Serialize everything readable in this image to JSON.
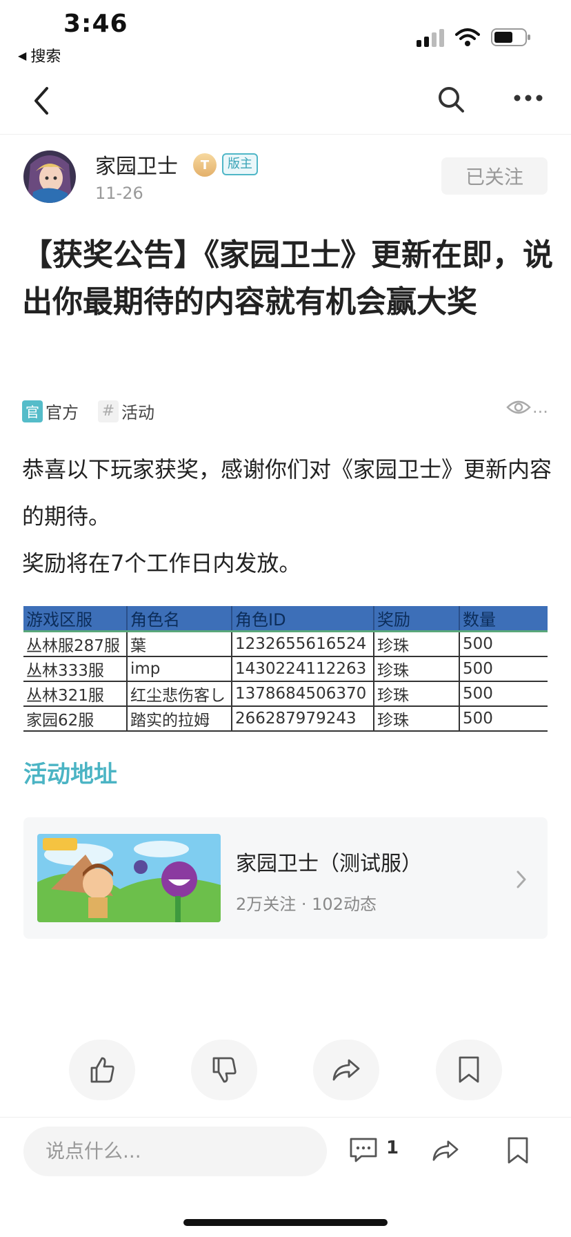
{
  "status_bar": {
    "time": "3:46",
    "back_app": "搜索"
  },
  "author": {
    "name": "家园卫士",
    "level": "T",
    "role_badge": "版主",
    "date": "11-26",
    "follow_label": "已关注"
  },
  "post": {
    "title": "【获奖公告】《家园卫士》更新在即，说出你最期待的内容就有机会赢大奖",
    "tags": [
      {
        "mark": "官",
        "label": "官方"
      },
      {
        "mark": "#",
        "label": "活动"
      }
    ],
    "views_suffix": "...",
    "paragraph_1": "恭喜以下玩家获奖，感谢你们对《家园卫士》更新内容的期待。",
    "paragraph_2": "奖励将在7个工作日内发放。"
  },
  "award_table": {
    "headers": [
      "游戏区服",
      "角色名",
      "角色ID",
      "奖励",
      "数量"
    ],
    "rows": [
      [
        "丛林服287服",
        "葉",
        "1232655616524",
        "珍珠",
        "500"
      ],
      [
        "丛林333服",
        "imp",
        "1430224112263",
        "珍珠",
        "500"
      ],
      [
        "丛林321服",
        "红尘悲伤客し",
        "1378684506370",
        "珍珠",
        "500"
      ],
      [
        "家园62服",
        "踏实的拉姆",
        "266287979243",
        "珍珠",
        "500"
      ]
    ]
  },
  "link_heading": "活动地址",
  "game_card": {
    "name": "家园卫士（测试服）",
    "stats": "2万关注 · 102动态"
  },
  "bottom_bar": {
    "comment_placeholder": "说点什么...",
    "comment_count": "1"
  },
  "colors": {
    "accent": "#4bb4c4",
    "table_header": "#3d6fb8"
  }
}
